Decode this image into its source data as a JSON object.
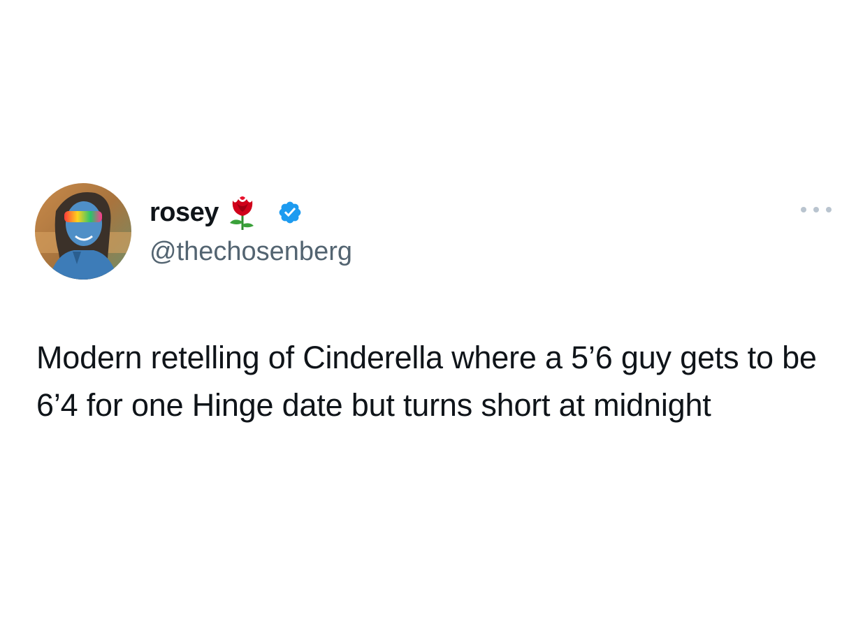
{
  "tweet": {
    "author": {
      "display_name": "rosey",
      "handle": "@thechosenberg",
      "verified": true
    },
    "name_emoji_icon": "rose-icon",
    "verified_icon": "verified-badge-icon",
    "more_icon": "more-options-icon",
    "text": "Modern retelling of Cinderella where a 5’6 guy gets to be 6’4 for one Hinge date but turns short at midnight"
  },
  "colors": {
    "text_primary": "#0f1419",
    "text_secondary": "#536471",
    "verified_blue": "#1d9bf0",
    "rose_red": "#d0021b",
    "more_dots": "#b9c4cf",
    "background": "#ffffff"
  }
}
